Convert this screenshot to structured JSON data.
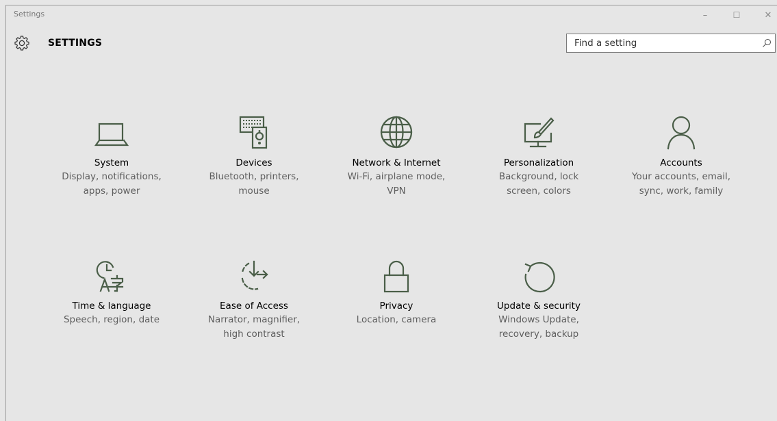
{
  "window": {
    "title": "Settings",
    "controls": {
      "minimize": "–",
      "maximize": "☐",
      "close": "✕"
    }
  },
  "header": {
    "title": "SETTINGS",
    "search_placeholder": "Find a setting"
  },
  "icon_color": "#4a5e48",
  "tiles": [
    {
      "name": "System",
      "desc_1": "Display, notifications,",
      "desc_2": "apps, power",
      "icon": "laptop-icon"
    },
    {
      "name": "Devices",
      "desc_1": "Bluetooth, printers,",
      "desc_2": "mouse",
      "icon": "devices-icon"
    },
    {
      "name": "Network & Internet",
      "desc_1": "Wi-Fi, airplane mode,",
      "desc_2": "VPN",
      "icon": "globe-icon"
    },
    {
      "name": "Personalization",
      "desc_1": "Background, lock",
      "desc_2": "screen, colors",
      "icon": "paintbrush-icon"
    },
    {
      "name": "Accounts",
      "desc_1": "Your accounts, email,",
      "desc_2": "sync, work, family",
      "icon": "person-icon"
    },
    {
      "name": "Time & language",
      "desc_1": "Speech, region, date",
      "desc_2": "",
      "icon": "time-language-icon"
    },
    {
      "name": "Ease of Access",
      "desc_1": "Narrator, magnifier,",
      "desc_2": "high contrast",
      "icon": "ease-of-access-icon"
    },
    {
      "name": "Privacy",
      "desc_1": "Location, camera",
      "desc_2": "",
      "icon": "lock-icon"
    },
    {
      "name": "Update & security",
      "desc_1": "Windows Update,",
      "desc_2": "recovery, backup",
      "icon": "update-icon"
    }
  ]
}
